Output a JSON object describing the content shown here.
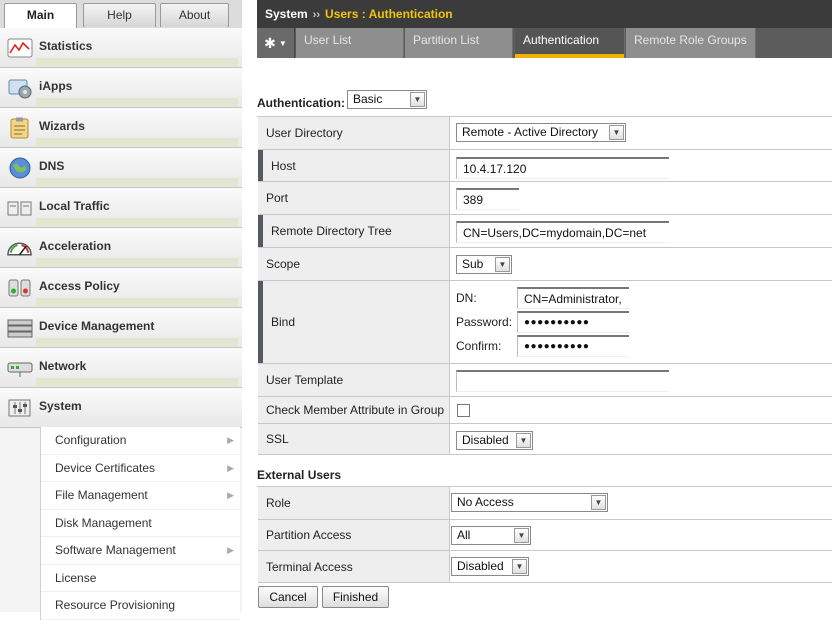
{
  "main_tabs": [
    "Main",
    "Help",
    "About"
  ],
  "nav": {
    "items": [
      {
        "label": "Statistics",
        "icon": "statistics-icon"
      },
      {
        "label": "iApps",
        "icon": "iapps-icon"
      },
      {
        "label": "Wizards",
        "icon": "wizards-icon"
      },
      {
        "label": "DNS",
        "icon": "dns-globe-icon"
      },
      {
        "label": "Local Traffic",
        "icon": "local-traffic-icon"
      },
      {
        "label": "Acceleration",
        "icon": "acceleration-gauge-icon"
      },
      {
        "label": "Access Policy",
        "icon": "access-policy-icon"
      },
      {
        "label": "Device Management",
        "icon": "device-management-icon"
      },
      {
        "label": "Network",
        "icon": "network-icon"
      },
      {
        "label": "System",
        "icon": "system-icon"
      }
    ],
    "system_sub": [
      {
        "label": "Configuration",
        "arrow": true
      },
      {
        "label": "Device Certificates",
        "arrow": true
      },
      {
        "label": "File Management",
        "arrow": true
      },
      {
        "label": "Disk Management",
        "arrow": false
      },
      {
        "label": "Software Management",
        "arrow": true
      },
      {
        "label": "License",
        "arrow": false
      },
      {
        "label": "Resource Provisioning",
        "arrow": false
      }
    ]
  },
  "header": {
    "section": "System",
    "separator": "››",
    "crumb": "Users : Authentication"
  },
  "subtabs": [
    "User List",
    "Partition List",
    "Authentication",
    "Remote Role Groups"
  ],
  "form": {
    "auth_label": "Authentication:",
    "auth_value": "Basic",
    "user_directory": {
      "label": "User Directory",
      "value": "Remote - Active Directory"
    },
    "host": {
      "label": "Host",
      "value": "10.4.17.120"
    },
    "port": {
      "label": "Port",
      "value": "389"
    },
    "tree": {
      "label": "Remote Directory Tree",
      "value": "CN=Users,DC=mydomain,DC=net"
    },
    "scope": {
      "label": "Scope",
      "value": "Sub"
    },
    "bind": {
      "label": "Bind",
      "dn_label": "DN:",
      "dn_value": "CN=Administrator,",
      "password_label": "Password:",
      "password_value": "●●●●●●●●●●",
      "confirm_label": "Confirm:",
      "confirm_value": "●●●●●●●●●●"
    },
    "user_template": {
      "label": "User Template",
      "value": ""
    },
    "check_member": {
      "label": "Check Member Attribute in Group",
      "checked": false
    },
    "ssl": {
      "label": "SSL",
      "value": "Disabled"
    }
  },
  "external": {
    "title": "External Users",
    "role": {
      "label": "Role",
      "value": "No Access"
    },
    "partition": {
      "label": "Partition Access",
      "value": "All"
    },
    "terminal": {
      "label": "Terminal Access",
      "value": "Disabled"
    }
  },
  "buttons": {
    "cancel": "Cancel",
    "finished": "Finished"
  },
  "colors": {
    "accent": "#f0b400",
    "crumb": "#f1c40f",
    "topbar": "#3b3b3b",
    "stripe": "#e1e6cf"
  }
}
